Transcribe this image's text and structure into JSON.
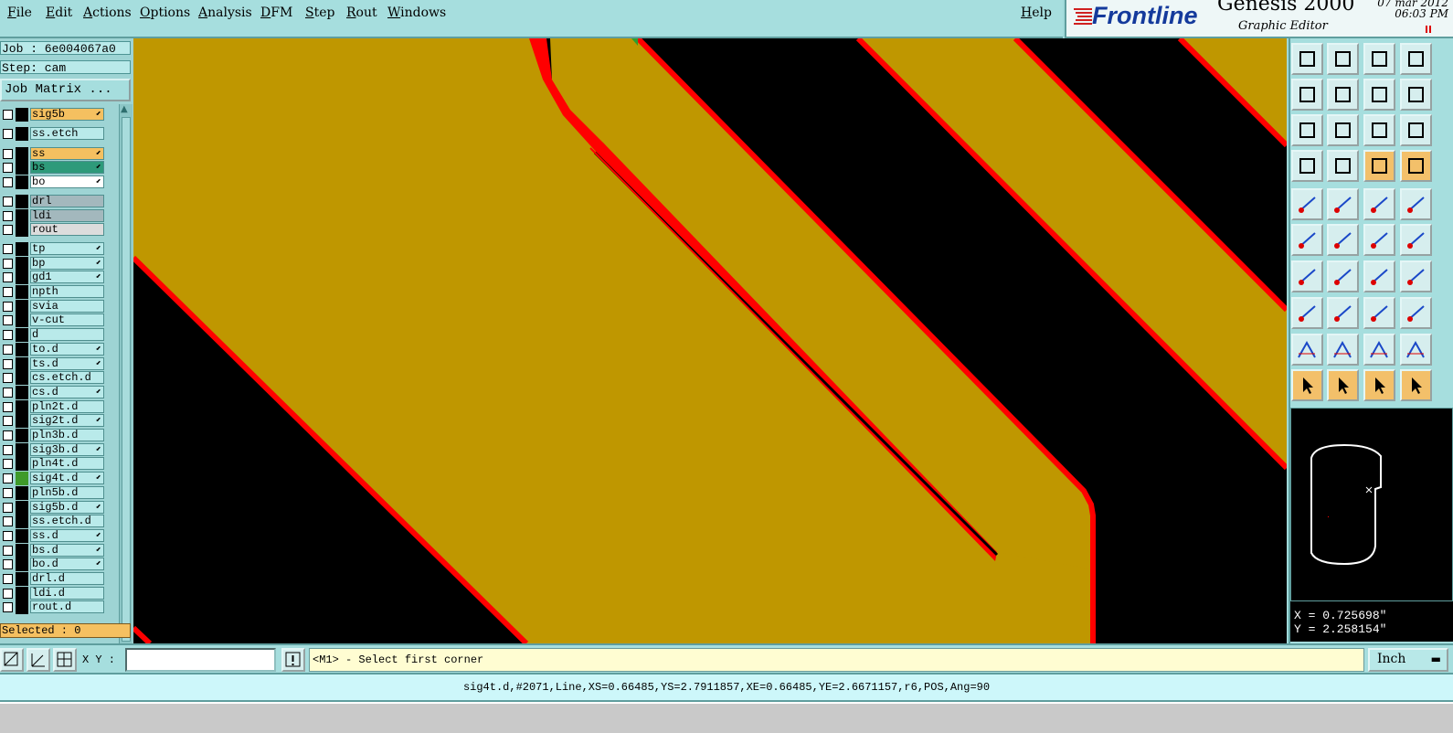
{
  "menu": [
    "File",
    "Edit",
    "Actions",
    "Options",
    "Analysis",
    "DFM",
    "Step",
    "Rout",
    "Windows"
  ],
  "help": "Help",
  "brand": {
    "logo": "Frontline",
    "product": "Genesis 2000",
    "subtitle": "Graphic Editor",
    "date": "07 mar 2012",
    "time": "06:03 PM"
  },
  "job": {
    "job_label": "Job : 6e004067a0",
    "step_label": "Step: cam",
    "matrix_button": "Job Matrix ..."
  },
  "layers": [
    {
      "name": "sig5b",
      "bg": "#f5c060",
      "arrow": true,
      "col": "#000000"
    },
    {
      "name": "ss.etch",
      "bg": "#b9eaea",
      "arrow": false,
      "col": "#000000"
    },
    {
      "name": "ss",
      "bg": "#f5c060",
      "arrow": true,
      "col": "#000000"
    },
    {
      "name": "bs",
      "bg": "#2e9a7a",
      "arrow": true,
      "col": "#000000"
    },
    {
      "name": "bo",
      "bg": "#ffffff",
      "arrow": true,
      "col": "#000000"
    },
    {
      "name": "drl",
      "bg": "#a3b8bd",
      "arrow": false,
      "col": "#000000"
    },
    {
      "name": "ldi",
      "bg": "#a3b8bd",
      "arrow": false,
      "col": "#000000"
    },
    {
      "name": "rout",
      "bg": "#dcdcdc",
      "arrow": false,
      "col": "#000000"
    },
    {
      "name": "tp",
      "bg": "#b9eaea",
      "arrow": true,
      "col": "#000000"
    },
    {
      "name": "bp",
      "bg": "#b9eaea",
      "arrow": true,
      "col": "#000000"
    },
    {
      "name": "gd1",
      "bg": "#b9eaea",
      "arrow": true,
      "col": "#000000"
    },
    {
      "name": "npth",
      "bg": "#b9eaea",
      "arrow": false,
      "col": "#000000"
    },
    {
      "name": "svia",
      "bg": "#b9eaea",
      "arrow": false,
      "col": "#000000"
    },
    {
      "name": "v-cut",
      "bg": "#b9eaea",
      "arrow": false,
      "col": "#000000"
    },
    {
      "name": "d",
      "bg": "#b9eaea",
      "arrow": false,
      "col": "#000000"
    },
    {
      "name": "to.d",
      "bg": "#b9eaea",
      "arrow": true,
      "col": "#000000"
    },
    {
      "name": "ts.d",
      "bg": "#b9eaea",
      "arrow": true,
      "col": "#000000"
    },
    {
      "name": "cs.etch.d",
      "bg": "#b9eaea",
      "arrow": false,
      "col": "#000000"
    },
    {
      "name": "cs.d",
      "bg": "#b9eaea",
      "arrow": true,
      "col": "#000000"
    },
    {
      "name": "pln2t.d",
      "bg": "#b9eaea",
      "arrow": false,
      "col": "#000000"
    },
    {
      "name": "sig2t.d",
      "bg": "#b9eaea",
      "arrow": true,
      "col": "#000000"
    },
    {
      "name": "pln3b.d",
      "bg": "#b9eaea",
      "arrow": false,
      "col": "#000000"
    },
    {
      "name": "sig3b.d",
      "bg": "#b9eaea",
      "arrow": true,
      "col": "#000000"
    },
    {
      "name": "pln4t.d",
      "bg": "#b9eaea",
      "arrow": false,
      "col": "#000000"
    },
    {
      "name": "sig4t.d",
      "bg": "#b9eaea",
      "arrow": true,
      "col": "#3f9a2a"
    },
    {
      "name": "pln5b.d",
      "bg": "#b9eaea",
      "arrow": false,
      "col": "#000000"
    },
    {
      "name": "sig5b.d",
      "bg": "#b9eaea",
      "arrow": true,
      "col": "#000000"
    },
    {
      "name": "ss.etch.d",
      "bg": "#b9eaea",
      "arrow": false,
      "col": "#000000"
    },
    {
      "name": "ss.d",
      "bg": "#b9eaea",
      "arrow": true,
      "col": "#000000"
    },
    {
      "name": "bs.d",
      "bg": "#b9eaea",
      "arrow": true,
      "col": "#000000"
    },
    {
      "name": "bo.d",
      "bg": "#b9eaea",
      "arrow": true,
      "col": "#000000"
    },
    {
      "name": "drl.d",
      "bg": "#b9eaea",
      "arrow": false,
      "col": "#000000"
    },
    {
      "name": "ldi.d",
      "bg": "#b9eaea",
      "arrow": false,
      "col": "#000000"
    },
    {
      "name": "rout.d",
      "bg": "#b9eaea",
      "arrow": false,
      "col": "#000000"
    }
  ],
  "selected": "Selected : 0",
  "coords": {
    "x": "X = 0.725698\"",
    "y": "Y = 2.258154\""
  },
  "cmd": {
    "xy_label": "X Y :",
    "message": "<M1> - Select first corner",
    "units": "Inch"
  },
  "status": "sig4t.d,#2071,Line,XS=0.66485,YS=2.7911857,XE=0.66485,YE=2.6671157,r6,POS,Ang=90",
  "colors": {
    "copper": "#bf9700",
    "highlight": "#ff0000",
    "background": "#000000"
  }
}
